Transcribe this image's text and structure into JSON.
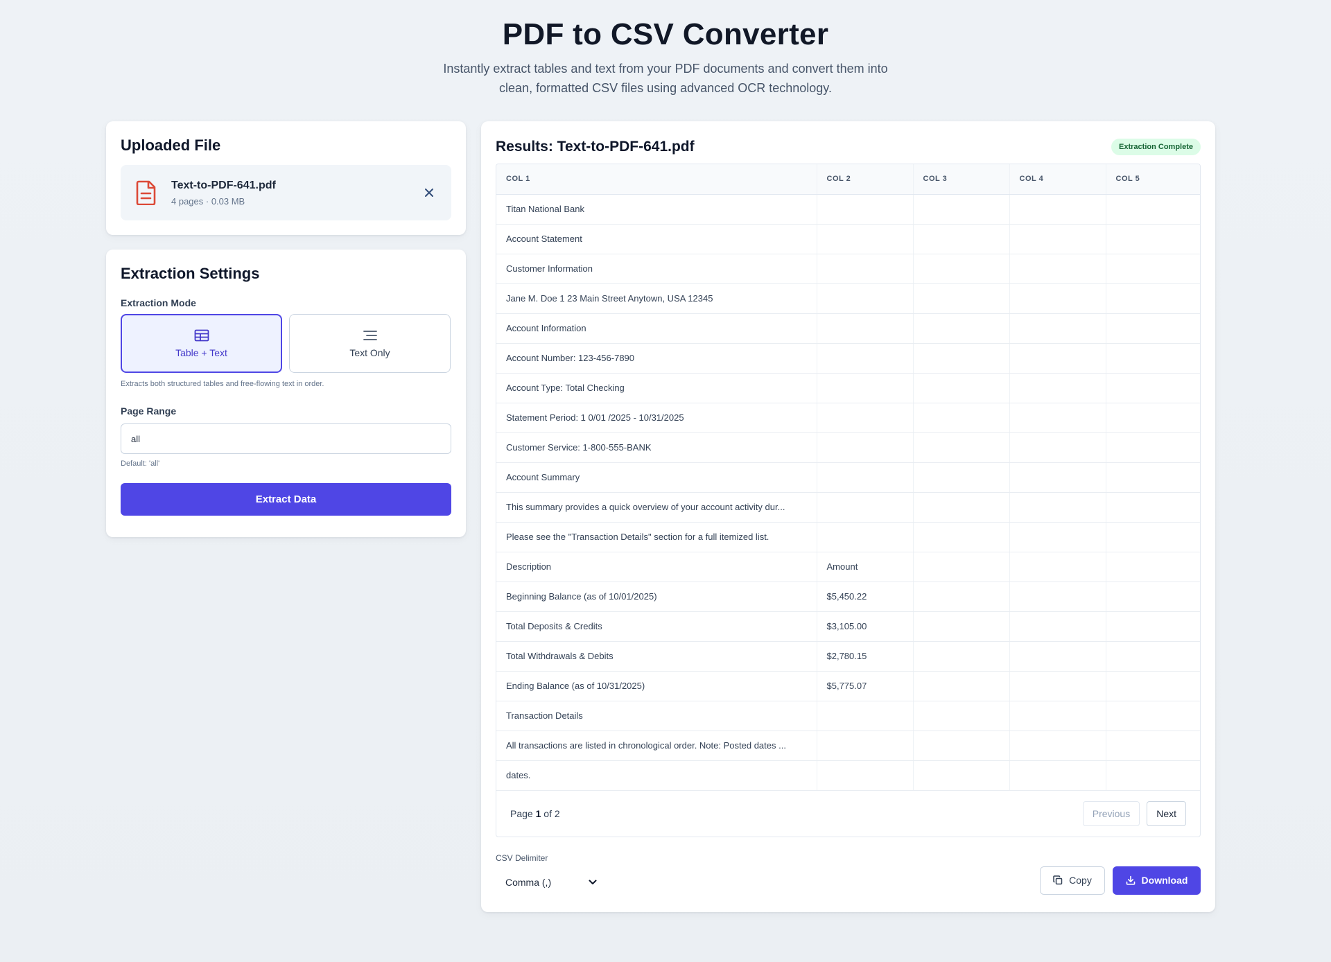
{
  "header": {
    "title": "PDF to CSV Converter",
    "subtitle_line1": "Instantly extract tables and text from your PDF documents and convert them into",
    "subtitle_line2": "clean, formatted CSV files using advanced OCR technology."
  },
  "upload": {
    "title": "Uploaded File",
    "file_name": "Text-to-PDF-641.pdf",
    "file_meta": "4 pages · 0.03 MB",
    "file_icon": "document-icon",
    "remove_icon": "close-icon"
  },
  "settings": {
    "title": "Extraction Settings",
    "mode_label": "Extraction Mode",
    "modes": [
      {
        "label": "Table + Text",
        "icon": "table-icon",
        "selected": true
      },
      {
        "label": "Text Only",
        "icon": "text-lines-icon",
        "selected": false
      }
    ],
    "mode_hint": "Extracts both structured tables and free-flowing text in order.",
    "page_range_label": "Page Range",
    "page_range_value": "all",
    "page_range_hint": "Default: 'all'",
    "extract_label": "Extract Data"
  },
  "results": {
    "title": "Results: Text-to-PDF-641.pdf",
    "status": "Extraction Complete",
    "columns": [
      "COL 1",
      "COL 2",
      "COL 3",
      "COL 4",
      "COL 5"
    ],
    "rows": [
      [
        "Titan National Bank",
        "",
        "",
        "",
        ""
      ],
      [
        "Account Statement",
        "",
        "",
        "",
        ""
      ],
      [
        "Customer Information",
        "",
        "",
        "",
        ""
      ],
      [
        "Jane M. Doe 1 23 Main Street Anytown, USA 12345",
        "",
        "",
        "",
        ""
      ],
      [
        "Account Information",
        "",
        "",
        "",
        ""
      ],
      [
        "Account Number: 123-456-7890",
        "",
        "",
        "",
        ""
      ],
      [
        "Account Type: Total Checking",
        "",
        "",
        "",
        ""
      ],
      [
        "Statement Period: 1 0/01 /2025 - 10/31/2025",
        "",
        "",
        "",
        ""
      ],
      [
        "Customer Service: 1-800-555-BANK",
        "",
        "",
        "",
        ""
      ],
      [
        "Account Summary",
        "",
        "",
        "",
        ""
      ],
      [
        "This summary provides a quick overview of your account activity dur...",
        "",
        "",
        "",
        ""
      ],
      [
        "Please see the \"Transaction Details\" section for a full itemized list.",
        "",
        "",
        "",
        ""
      ],
      [
        "Description",
        "Amount",
        "",
        "",
        ""
      ],
      [
        "Beginning Balance (as of 10/01/2025)",
        "$5,450.22",
        "",
        "",
        ""
      ],
      [
        "Total Deposits & Credits",
        "$3,105.00",
        "",
        "",
        ""
      ],
      [
        "Total Withdrawals & Debits",
        "$2,780.15",
        "",
        "",
        ""
      ],
      [
        "Ending Balance (as of 10/31/2025)",
        "$5,775.07",
        "",
        "",
        ""
      ],
      [
        "Transaction Details",
        "",
        "",
        "",
        ""
      ],
      [
        "All transactions are listed in chronological order. Note: Posted dates ...",
        "",
        "",
        "",
        ""
      ],
      [
        "dates.",
        "",
        "",
        "",
        ""
      ]
    ],
    "pager": {
      "prefix": "Page",
      "current": "1",
      "middle": "of",
      "total": "2",
      "previous_label": "Previous",
      "next_label": "Next"
    },
    "delimiter_label": "CSV Delimiter",
    "delimiter_value": "Comma (,)",
    "copy_label": "Copy",
    "download_label": "Download"
  },
  "colors": {
    "accent": "#4f46e5",
    "accent_light": "#eef2ff",
    "success_bg": "#dcfce7",
    "success_text": "#166534",
    "file_icon": "#dc4a38"
  }
}
